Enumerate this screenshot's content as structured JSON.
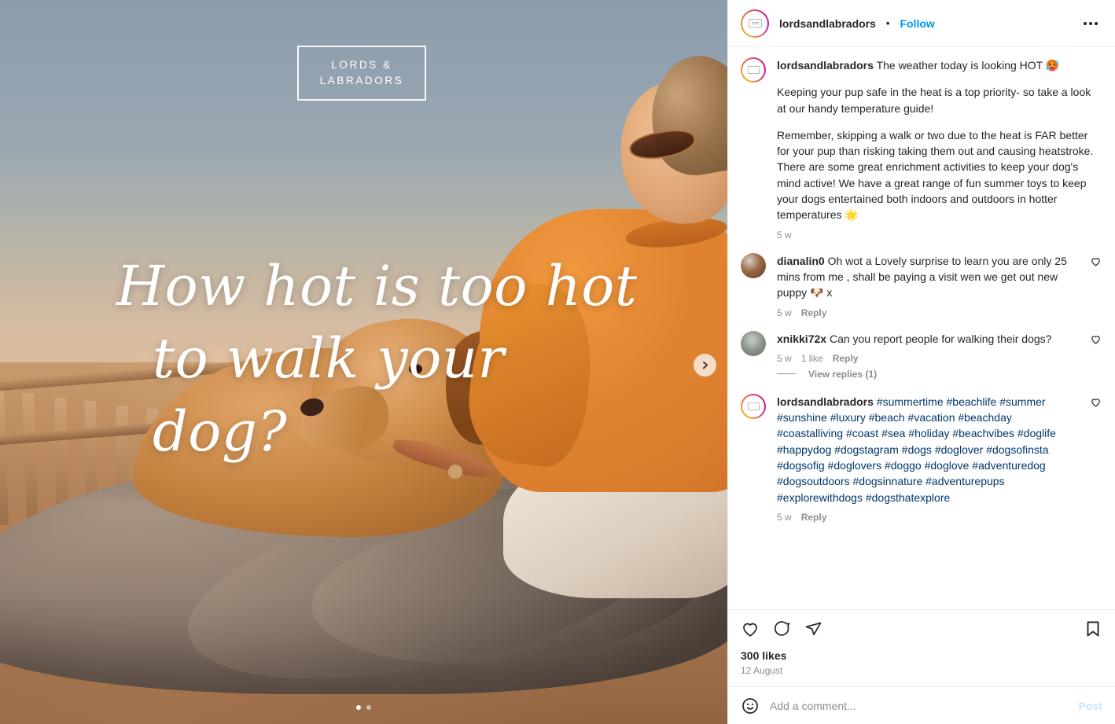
{
  "header": {
    "username": "lordsandlabradors",
    "separator": "•",
    "follow_label": "Follow",
    "menu_icon": "ellipsis-icon"
  },
  "media": {
    "logo_line1": "LORDS &",
    "logo_line2": "LABRADORS",
    "headline_line1": "How hot is too hot",
    "headline_line2": "to walk your dog?",
    "next_icon": "chevron-right-icon",
    "carousel_total": 2,
    "carousel_active": 1
  },
  "caption": {
    "username": "lordsandlabradors",
    "text_1": "The weather today is looking HOT 🥵",
    "text_2": "Keeping your pup safe in the heat is a top priority- so take a look at our handy temperature guide!",
    "text_3": "Remember, skipping a walk or two due to the heat is FAR better for your pup than risking taking them out and causing heatstroke. There are some great enrichment activities to keep your dog's mind active! We have a great range of fun summer toys to keep your dogs entertained both indoors and outdoors in hotter temperatures 🌟",
    "time": "5 w"
  },
  "comments": [
    {
      "username": "dianalin0",
      "text": "Oh wot a Lovely surprise to learn you are only 25 mins from me , shall be paying a visit wen we get out new puppy 🐶 x",
      "time": "5 w",
      "likes": "",
      "reply_label": "Reply",
      "like_icon": "heart-outline-icon"
    },
    {
      "username": "xnikki72x",
      "text": "Can you report people for walking their dogs?",
      "time": "5 w",
      "likes": "1 like",
      "reply_label": "Reply",
      "like_icon": "heart-outline-icon"
    }
  ],
  "view_replies": {
    "label": "View replies (1)"
  },
  "hashtag_comment": {
    "username": "lordsandlabradors",
    "hashtags": "#summertime #beachlife #summer #sunshine #luxury #beach #vacation #beachday #coastalliving #coast #sea #holiday #beachvibes #doglife #happydog #dogstagram #dogs #doglover #dogsofinsta #dogsofig #doglovers #doggo #doglove #adventuredog #dogsoutdoors #dogsinnature #adventurepups #explorewithdogs #dogsthatexplore",
    "time": "5 w",
    "reply_label": "Reply",
    "like_icon": "heart-outline-icon"
  },
  "actions": {
    "like_icon": "heart-outline-icon",
    "comment_icon": "comment-bubble-icon",
    "share_icon": "paper-plane-icon",
    "save_icon": "bookmark-icon",
    "likes_count": "300 likes",
    "date": "12 August"
  },
  "add_comment": {
    "emoji_icon": "smiley-face-icon",
    "placeholder": "Add a comment...",
    "post_label": "Post"
  },
  "colors": {
    "link_blue": "#0095f6",
    "hashtag_blue": "#00376b",
    "muted": "#8e8e8e",
    "text": "#262626"
  }
}
